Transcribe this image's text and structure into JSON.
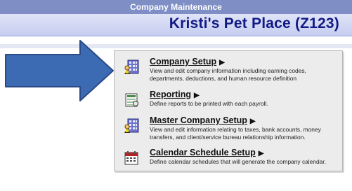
{
  "header": {
    "section_title": "Company Maintenance",
    "company_name": "Kristi's Pet Place (Z123)"
  },
  "menu": {
    "items": [
      {
        "title": "Company Setup",
        "caret": "▶",
        "description": "View and edit company information including earning codes, departments, deductions, and human resource definition",
        "icon": "company-setup-icon"
      },
      {
        "title": "Reporting",
        "caret": "▶",
        "description": "Define reports to be printed with each payroll.",
        "icon": "reporting-icon"
      },
      {
        "title": "Master Company Setup",
        "caret": "▶",
        "description": "View and edit information relating to taxes, bank accounts, money transfers, and client/service bureau relationship information.",
        "icon": "master-company-icon"
      },
      {
        "title": "Calendar Schedule Setup",
        "caret": "▶",
        "description": "Define calendar schedules that will generate the company calendar.",
        "icon": "calendar-icon"
      }
    ]
  },
  "colors": {
    "header_bar": "#7f8ec4",
    "company_name": "#121a85",
    "arrow_fill": "#3d6bb3",
    "arrow_stroke": "#2a4a86",
    "panel_bg": "#ececec"
  }
}
